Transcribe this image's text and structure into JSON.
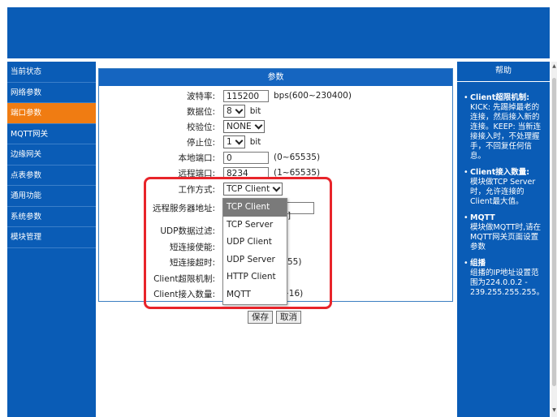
{
  "sidebar": {
    "items": [
      {
        "label": "当前状态"
      },
      {
        "label": "网络参数"
      },
      {
        "label": "端口参数"
      },
      {
        "label": "MQTT网关"
      },
      {
        "label": "边缘网关"
      },
      {
        "label": "点表参数"
      },
      {
        "label": "通用功能"
      },
      {
        "label": "系统参数"
      },
      {
        "label": "模块管理"
      }
    ],
    "active_index": 2
  },
  "main": {
    "title": "参数",
    "baud": {
      "label": "波特率:",
      "value": "115200",
      "unit": "bps(600~230400)"
    },
    "databits": {
      "label": "数据位:",
      "value": "8",
      "unit": "bit"
    },
    "parity": {
      "label": "校验位:",
      "value": "NONE"
    },
    "stopbits": {
      "label": "停止位:",
      "value": "1",
      "unit": "bit"
    },
    "local_port": {
      "label": "本地端口:",
      "value": "0",
      "range": "(0~65535)"
    },
    "remote_port": {
      "label": "远程端口:",
      "value": "8234",
      "range": "(1~65535)"
    },
    "work_mode": {
      "label": "工作方式:",
      "value": "TCP Client"
    },
    "remote_server": {
      "label": "远程服务器地址:",
      "tail": "]"
    },
    "udp_filter": {
      "label": "UDP数据过滤:"
    },
    "short_enable": {
      "label": "短连接使能:"
    },
    "short_timeout": {
      "label": "短连接超时:",
      "tail": "55)"
    },
    "client_limit": {
      "label": "Client超限机制:"
    },
    "client_count": {
      "label": "Client接入数量:",
      "tail": "~16)"
    },
    "dropdown_options": [
      "TCP Client",
      "TCP Server",
      "UDP Client",
      "UDP Server",
      "HTTP Client",
      "MQTT"
    ],
    "save_label": "保存",
    "cancel_label": "取消"
  },
  "help": {
    "title": "帮助",
    "items": [
      {
        "title": "Client超限机制:",
        "text": "KICK: 先踢掉最老的连接，然后接入新的连接。KEEP: 当新连接接入时，不处理握手，不回复任何信息。"
      },
      {
        "title": "Client接入数量:",
        "text": "模块做TCP Server时，允许连接的Client最大值。"
      },
      {
        "title": "MQTT",
        "text": "模块做MQTT时,请在MQTT网关页面设置参数"
      },
      {
        "title": "组播",
        "text": "组播的IP地址设置范围为224.0.0.2 - 239.255.255.255。"
      }
    ]
  },
  "colors": {
    "brand": "#0a5cb6",
    "active": "#f07c12",
    "highlight": "#e8242a"
  }
}
